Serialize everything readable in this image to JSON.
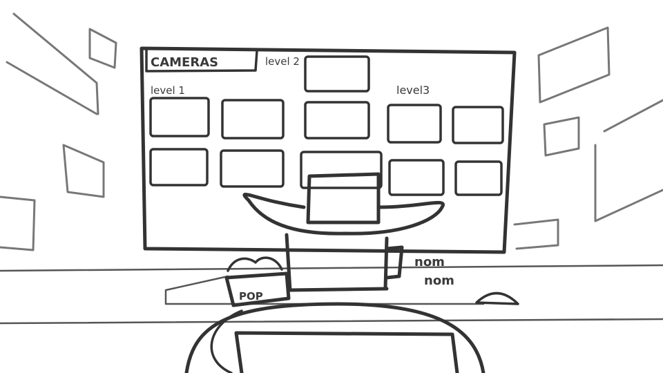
{
  "board": {
    "title": "CAMERAS",
    "level2": "level 2",
    "level1": "level 1",
    "level3": "level3"
  },
  "popcorn_label": "POP",
  "sound": {
    "line1": "nom",
    "line2": "nom"
  }
}
